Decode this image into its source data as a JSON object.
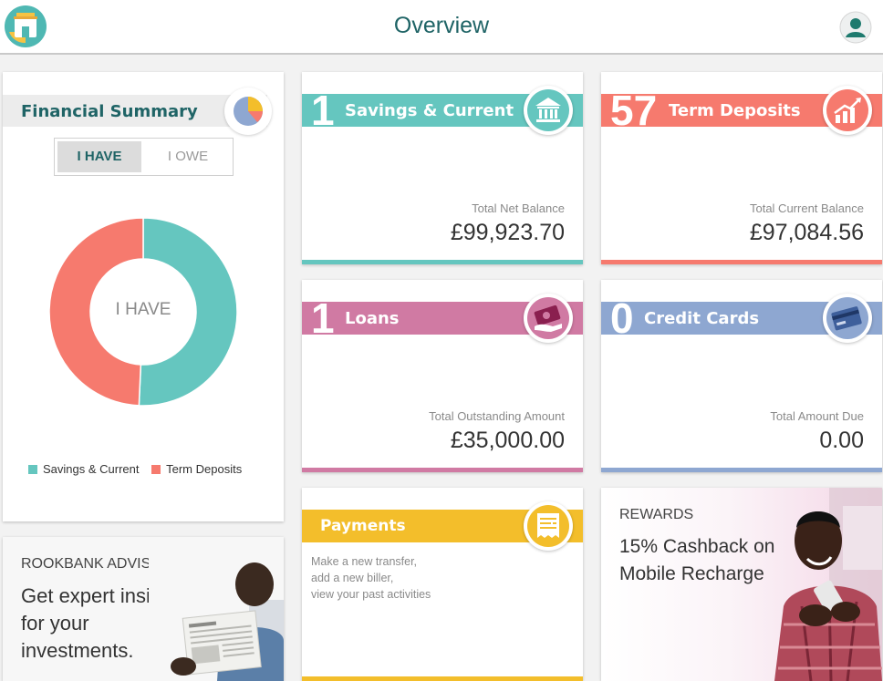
{
  "header": {
    "title": "Overview",
    "logo_icon": "bank-logo-icon",
    "profile_icon": "user-avatar-icon"
  },
  "financial_summary": {
    "title": "Financial Summary",
    "toggle": {
      "have": "I HAVE",
      "owe": "I OWE",
      "selected": "I HAVE"
    },
    "center_label": "I HAVE",
    "legend": [
      {
        "label": "Savings & Current",
        "color": "#65c6bf"
      },
      {
        "label": "Term Deposits",
        "color": "#f67a6e"
      }
    ]
  },
  "chart_data": {
    "type": "pie",
    "series": [
      {
        "name": "Savings & Current",
        "value": 99923.7,
        "color": "#65c6bf"
      },
      {
        "name": "Term Deposits",
        "value": 97084.56,
        "color": "#f67a6e"
      }
    ]
  },
  "tiles": {
    "savings": {
      "count": "1",
      "name": "Savings & Current",
      "sub": "Total Net Balance",
      "amount": "£99,923.70",
      "color": "#65c6bf",
      "icon": "bank-building-icon"
    },
    "term": {
      "count": "57",
      "name": "Term Deposits",
      "sub": "Total Current Balance",
      "amount": "£97,084.56",
      "color": "#f67a6e",
      "icon": "growth-chart-icon"
    },
    "loans": {
      "count": "1",
      "name": "Loans",
      "sub": "Total Outstanding Amount",
      "amount": "£35,000.00",
      "color": "#d07aa3",
      "icon": "money-hand-icon"
    },
    "credit": {
      "count": "0",
      "name": "Credit Cards",
      "sub": "Total Amount Due",
      "amount": "0.00",
      "color": "#8ea7d1",
      "icon": "credit-card-icon"
    }
  },
  "payments": {
    "title": "Payments",
    "lines": [
      "Make a new transfer,",
      "add a new biller,",
      "view your past activities"
    ],
    "color": "#f3be2b",
    "icon": "receipt-icon"
  },
  "advisors": {
    "kicker": "ROOKBANK ADVISORS",
    "headline": [
      "Get expert insights",
      "for your",
      "investments."
    ]
  },
  "rewards": {
    "kicker": "REWARDS",
    "headline": [
      "15% Cashback on",
      "Mobile Recharge"
    ]
  }
}
